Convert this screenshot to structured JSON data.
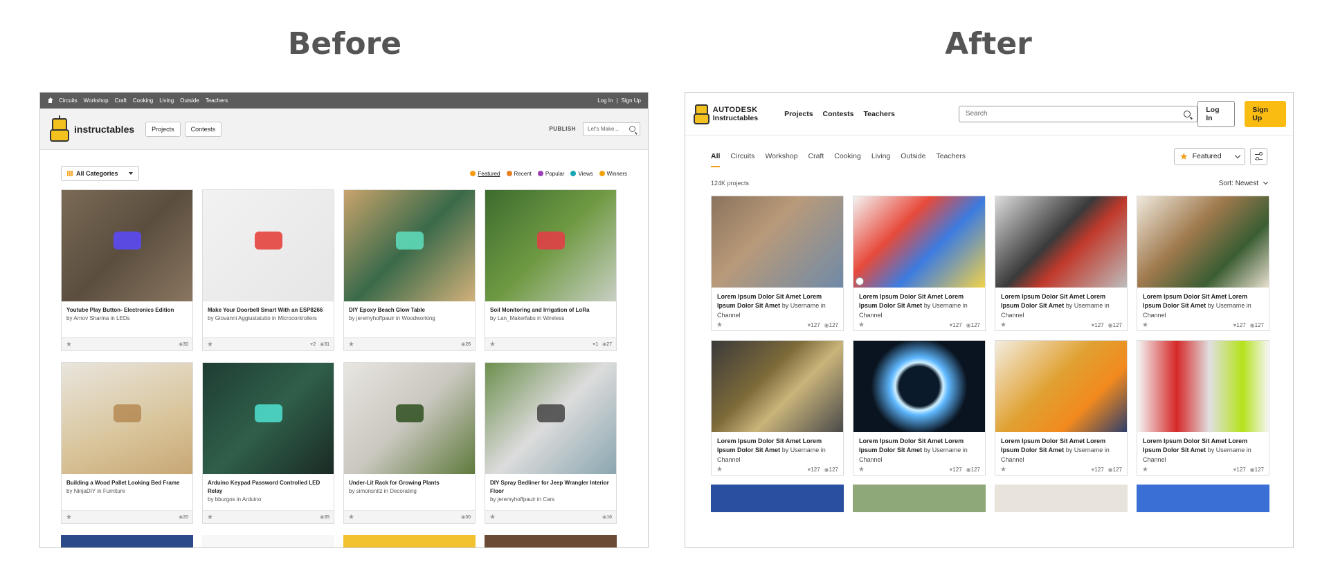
{
  "headings": {
    "before": "Before",
    "after": "After"
  },
  "before": {
    "topbar": {
      "links": [
        "Circuits",
        "Workshop",
        "Craft",
        "Cooking",
        "Living",
        "Outside",
        "Teachers"
      ],
      "login": "Log In",
      "separator": "|",
      "signup": "Sign Up"
    },
    "header": {
      "logo_text": "instructables",
      "buttons": [
        "Projects",
        "Contests"
      ],
      "publish": "PUBLISH",
      "search_placeholder": "Let's Make..."
    },
    "filter": {
      "all_categories": "All Categories",
      "sorts": [
        {
          "label": "Featured",
          "color": "#f39c12",
          "active": true
        },
        {
          "label": "Recent",
          "color": "#e67e22"
        },
        {
          "label": "Popular",
          "color": "#9b3fb5"
        },
        {
          "label": "Views",
          "color": "#16a6b6"
        },
        {
          "label": "Winners",
          "color": "#f1a209"
        }
      ]
    },
    "cards": [
      {
        "title": "Youtube Play Button- Electronics Edition",
        "by_prefix": "by",
        "author": "Arnov Sharma",
        "in": "in",
        "channel": "LEDs",
        "likes": "",
        "views": "30",
        "bg": "linear-gradient(135deg,#7a6a55 0%,#5b4e3f 50%,#8a7660 100%)",
        "accent": "#5a49ff"
      },
      {
        "title": "Make Your Doorbell Smart With an ESP8266",
        "by_prefix": "by",
        "author": "Giovanni Aggiustatutto",
        "in": "in",
        "channel": "Microcontrollers",
        "likes": "2",
        "views": "31",
        "bg": "linear-gradient(135deg,#f2f2f2 0%,#e6e6e6 100%)",
        "accent": "#e53935"
      },
      {
        "title": "DIY Epoxy Beach Glow Table",
        "by_prefix": "by",
        "author": "jeremyhoffpauir",
        "in": "in",
        "channel": "Woodworking",
        "likes": "",
        "views": "26",
        "bg": "linear-gradient(135deg,#c9a46c 0%,#3a6a4a 50%,#d2b17a 100%)",
        "accent": "#5fe0c0"
      },
      {
        "title": "Soil Monitoring and Irrigation of LoRa",
        "by_prefix": "by",
        "author": "Lan_Makerfabs",
        "in": "in",
        "channel": "Wireless",
        "likes": "1",
        "views": "27",
        "bg": "linear-gradient(135deg,#3d6b2e 0%,#6f9a43 50%,#c9cfc4 100%)",
        "accent": "#e63946"
      },
      {
        "title": "Building a Wood Pallet Looking Bed Frame",
        "by_prefix": "by",
        "author": "NinjaDIY",
        "in": "in",
        "channel": "Furniture",
        "likes": "",
        "views": "20",
        "bg": "linear-gradient(160deg,#e9e5dd 0%,#d8c49a 60%,#c8a775 100%)",
        "accent": "#b58a54"
      },
      {
        "title": "Arduino Keypad Password Controlled LED Relay",
        "by_prefix": "by",
        "author": "bburgos",
        "in": "in",
        "channel": "Arduino",
        "likes": "",
        "views": "35",
        "bg": "linear-gradient(135deg,#1f3d33 0%,#2f5f4a 50%,#1a2a24 100%)",
        "accent": "#4fe0d0"
      },
      {
        "title": "Under-Lit Rack for Growing Plants",
        "by_prefix": "by",
        "author": "simonsnitz",
        "in": "in",
        "channel": "Decorating",
        "likes": "",
        "views": "30",
        "bg": "linear-gradient(135deg,#e8e6e0 0%,#c9c7bf 50%,#5f7a3c 100%)",
        "accent": "#2e4f1f"
      },
      {
        "title": "DIY Spray Bedliner for Jeep Wrangler Interior Floor",
        "by_prefix": "by",
        "author": "jeremyhoffpauir",
        "in": "in",
        "channel": "Cars",
        "likes": "",
        "views": "16",
        "bg": "linear-gradient(135deg,#6d8f4e 0%,#dcdcdc 50%,#8aa6b0 100%)",
        "accent": "#444"
      }
    ],
    "row3_colors": [
      "#2a4a8a",
      "#f7f7f7",
      "#f2c230",
      "#6b4a36"
    ]
  },
  "after": {
    "header": {
      "brand_line1": "AUTODESK",
      "brand_line2": "Instructables",
      "nav": [
        "Projects",
        "Contests",
        "Teachers"
      ],
      "search_placeholder": "Search",
      "login": "Log In",
      "signup": "Sign Up"
    },
    "tabs": [
      "All",
      "Circuits",
      "Workshop",
      "Craft",
      "Cooking",
      "Living",
      "Outside",
      "Teachers"
    ],
    "featured": "Featured",
    "count": "124K projects",
    "sort": "Sort: Newest",
    "cards": [
      {
        "title": "Lorem Ipsum Dolor Sit Amet Lorem Ipsum Dolor Sit Amet",
        "by_prefix": "by",
        "author": "Username",
        "in": "in",
        "channel": "Channel",
        "likes": "127",
        "views": "127",
        "bg": "linear-gradient(135deg,#8a735d 0%,#b99a79 40%,#6f8aa8 100%)"
      },
      {
        "title": "Lorem Ipsum Dolor Sit Amet Lorem Ipsum Dolor Sit Amet",
        "by_prefix": "by",
        "author": "Username",
        "in": "in",
        "channel": "Channel",
        "likes": "127",
        "views": "127",
        "bg": "linear-gradient(135deg,#f3f3f3 0%,#e84a3b 35%,#3c7be0 60%,#f2d34a 100%)"
      },
      {
        "title": "Lorem Ipsum Dolor Sit Amet Lorem Ipsum Dolor Sit Amet",
        "by_prefix": "by",
        "author": "Username",
        "in": "in",
        "channel": "Channel",
        "likes": "127",
        "views": "127",
        "bg": "linear-gradient(135deg,#dcdcdc 0%,#3a3a3a 45%,#c0392b 60%,#bdbdbd 100%)"
      },
      {
        "title": "Lorem Ipsum Dolor Sit Amet Lorem Ipsum Dolor Sit Amet",
        "by_prefix": "by",
        "author": "Username",
        "in": "in",
        "channel": "Channel",
        "likes": "127",
        "views": "127",
        "bg": "linear-gradient(135deg,#efe9dd 0%,#a07a4e 40%,#3b5d33 70%,#e8e0cf 100%)"
      },
      {
        "title": "Lorem Ipsum Dolor Sit Amet Lorem Ipsum Dolor Sit Amet",
        "by_prefix": "by",
        "author": "Username",
        "in": "in",
        "channel": "Channel",
        "likes": "127",
        "views": "127",
        "bg": "linear-gradient(135deg,#3a3a3a 0%,#7d6a3a 40%,#c9b47a 60%,#4a4a4a 100%)"
      },
      {
        "title": "Lorem Ipsum Dolor Sit Amet Lorem Ipsum Dolor Sit Amet",
        "by_prefix": "by",
        "author": "Username",
        "in": "in",
        "channel": "Channel",
        "likes": "127",
        "views": "127",
        "bg": "radial-gradient(circle at 50% 50%,#0b1a2a 25%,#cfefff 30%,#5fb8ff 36%,#0a1420 60%)"
      },
      {
        "title": "Lorem Ipsum Dolor Sit Amet Lorem Ipsum Dolor Sit Amet",
        "by_prefix": "by",
        "author": "Username",
        "in": "in",
        "channel": "Channel",
        "likes": "127",
        "views": "127",
        "bg": "linear-gradient(135deg,#f3ede0 0%,#e0a030 45%,#f28a1f 70%,#2f3e6a 100%)"
      },
      {
        "title": "Lorem Ipsum Dolor Sit Amet Lorem Ipsum Dolor Sit Amet",
        "by_prefix": "by",
        "author": "Username",
        "in": "in",
        "channel": "Channel",
        "likes": "127",
        "views": "127",
        "bg": "linear-gradient(90deg,#f5f5f5 0%,#d62828 30%,#e0e0e0 55%,#b5e21a 80%,#f5f5f5 100%)"
      }
    ],
    "row3_colors": [
      "#2b4fa0",
      "#8fa87a",
      "#e8e4dc",
      "#3a6fd6"
    ]
  }
}
